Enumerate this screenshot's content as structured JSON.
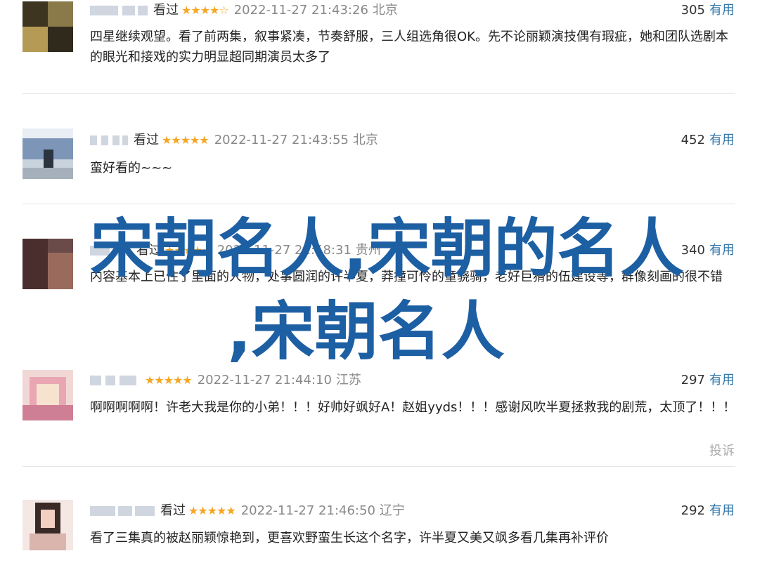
{
  "reviews": [
    {
      "watched": "看过",
      "stars": "★★★★☆",
      "time": "2022-11-27 21:43:26",
      "location": "北京",
      "useful_count": "305",
      "useful_label": "有用",
      "text": "四星继续观望。看了前两集，叙事紧凑，节奏舒服，三人组选角很OK。先不论丽颖演技偶有瑕疵，她和团队选剧本的眼光和接戏的实力明显超同期演员太多了"
    },
    {
      "watched": "看过",
      "stars": "★★★★★",
      "time": "2022-11-27 21:43:55",
      "location": "北京",
      "useful_count": "452",
      "useful_label": "有用",
      "text": "蛮好看的~~~"
    },
    {
      "watched": "看过",
      "stars": "★★★★☆",
      "time": "2022-11-27 21:58:31",
      "location": "贵州",
      "useful_count": "340",
      "useful_label": "有用",
      "text": "内容基本上已住了里面的人物，处事圆润的许半夏，莽撞可怜的童骁骑，老好巨猾的伍建设等，群像刻画的很不错"
    },
    {
      "watched": "",
      "stars": "★★★★★",
      "time": "2022-11-27 21:44:10",
      "location": "江苏",
      "useful_count": "297",
      "useful_label": "有用",
      "text": "啊啊啊啊啊！许老大我是你的小弟！！！好帅好飒好A！赵姐yyds！！！感谢风吹半夏拯救我的剧荒，太顶了！！！",
      "report": "投诉"
    },
    {
      "watched": "看过",
      "stars": "★★★★★",
      "time": "2022-11-27 21:46:50",
      "location": "辽宁",
      "useful_count": "292",
      "useful_label": "有用",
      "text": "看了三集真的被赵丽颖惊艳到，更喜欢野蛮生长这个名字，许半夏又美又飒多看几集再补评价"
    }
  ],
  "overlay": {
    "line1": "宋朝名人,宋朝的名人",
    "line2": ",宋朝名人",
    "color": "#1d5fa3"
  }
}
